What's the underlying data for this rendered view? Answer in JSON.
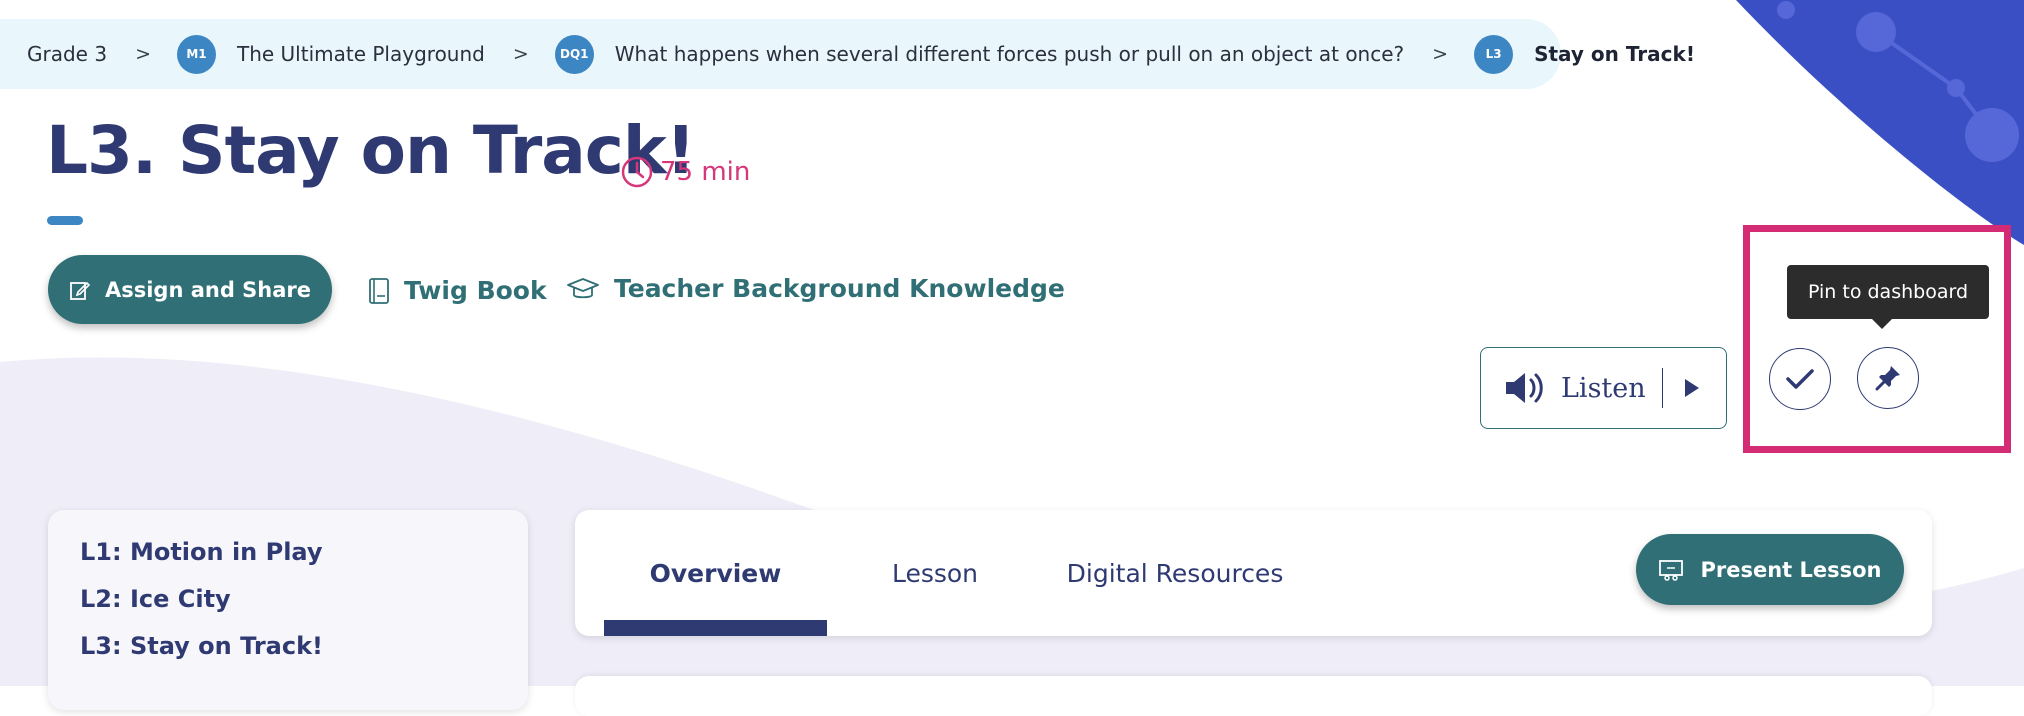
{
  "breadcrumb": {
    "grade": "Grade 3",
    "separator": ">",
    "module": {
      "badge": "M1",
      "label": "The Ultimate Playground"
    },
    "question": {
      "badge": "DQ1",
      "label": "What happens when several different forces push or pull on an object at once?"
    },
    "lesson": {
      "badge": "L3",
      "label": "Stay on Track!"
    }
  },
  "header": {
    "title": "L3. Stay on Track!",
    "duration": "75 min"
  },
  "actions": {
    "assign_label": "Assign and Share",
    "twig_book_label": "Twig Book",
    "teacher_knowledge_label": "Teacher Background Knowledge"
  },
  "listen": {
    "label": "Listen"
  },
  "tooltip": {
    "pin": "Pin to dashboard"
  },
  "lesson_list": [
    "L1: Motion in Play",
    "L2: Ice City",
    "L3: Stay on Track!"
  ],
  "tabs": [
    {
      "label": "Overview",
      "active": true
    },
    {
      "label": "Lesson",
      "active": false
    },
    {
      "label": "Digital Resources",
      "active": false
    }
  ],
  "present_label": "Present Lesson",
  "icons": {
    "module_badge": "circle-badge",
    "clock": "clock-icon",
    "assign": "edit-share-icon",
    "book": "book-icon",
    "teacher": "graduation-cap-icon",
    "speaker": "speaker-icon",
    "play": "play-icon",
    "check": "check-icon",
    "pin": "pin-icon",
    "present": "presentation-icon"
  },
  "colors": {
    "navy": "#2f3a73",
    "teal": "#2f6f75",
    "badge_blue": "#3d86c4",
    "accent_pink": "#d6367a",
    "highlight": "#d32b74",
    "breadcrumb_bg": "#e9f6fb",
    "decor_blue": "#3b4fc4",
    "curve_bg": "#efedf7"
  }
}
